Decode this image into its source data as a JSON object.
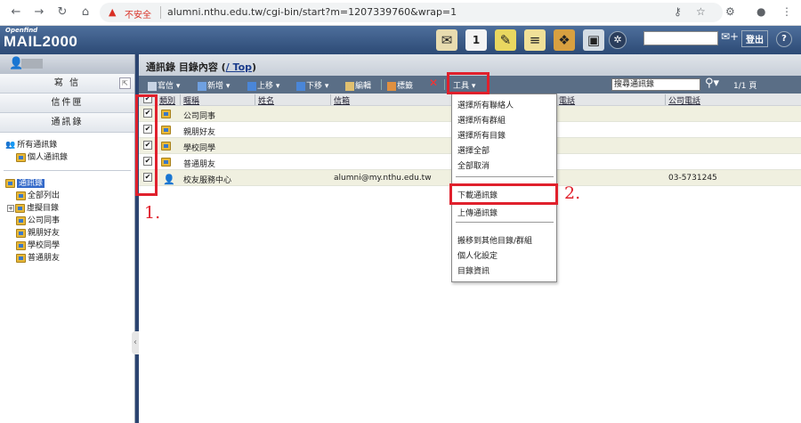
{
  "browser": {
    "insecure_label": "不安全",
    "url": "alumni.nthu.edu.tw/cgi-bin/start?m=1207339760&wrap=1"
  },
  "app": {
    "logo_small": "Openfind",
    "logo_main": "MAIL2000",
    "logout": "登出",
    "help": "?"
  },
  "sidebar": {
    "compose": "寫 信",
    "inbox": "信件匣",
    "contacts": "通訊錄",
    "contact_tree": [
      {
        "label": "所有通訊錄"
      },
      {
        "label": "個人通訊錄"
      }
    ],
    "folder_tree": {
      "root": "通訊錄",
      "items": [
        "全部列出",
        "虛擬目錄",
        "公司同事",
        "親朋好友",
        "學校同學",
        "普通朋友"
      ]
    }
  },
  "main": {
    "title_prefix": "通訊錄 目錄內容 (",
    "title_link": "/ Top",
    "title_suffix": ")",
    "toolbar": {
      "write": "寫信",
      "add": "新增",
      "move_up": "上移",
      "move_down": "下移",
      "edit": "編輯",
      "tag": "標籤",
      "tools": "工具",
      "search_placeholder": "搜尋通訊錄",
      "pages": "1/1 頁"
    },
    "columns": {
      "type": "類別",
      "nickname": "暱稱",
      "name": "姓名",
      "email": "信箱",
      "phone": "電話",
      "company_phone": "公司電話"
    },
    "rows": [
      {
        "nickname": "公司同事",
        "name": "",
        "email": "",
        "company_phone": ""
      },
      {
        "nickname": "親朋好友",
        "name": "",
        "email": "",
        "company_phone": ""
      },
      {
        "nickname": "學校同學",
        "name": "",
        "email": "",
        "company_phone": ""
      },
      {
        "nickname": "普通朋友",
        "name": "",
        "email": "",
        "company_phone": ""
      },
      {
        "nickname": "校友服務中心",
        "name": "",
        "email": "alumni@my.nthu.edu.tw",
        "company_phone": "03-5731245"
      }
    ]
  },
  "tools_menu": {
    "select_contacts": "選擇所有聯絡人",
    "select_groups": "選擇所有群組",
    "select_folders": "選擇所有目錄",
    "select_all": "選擇全部",
    "deselect_all": "全部取消",
    "download": "下載通訊錄",
    "upload": "上傳通訊錄",
    "move_to": "搬移到其他目錄/群組",
    "personalize": "個人化設定",
    "folder_info": "目錄資訊"
  },
  "annotations": {
    "step1": "1.",
    "step2": "2."
  },
  "colors": {
    "annotation_red": "#e0202c",
    "header_blue": "#2c4a75",
    "toolbar": "#5a6e86"
  }
}
